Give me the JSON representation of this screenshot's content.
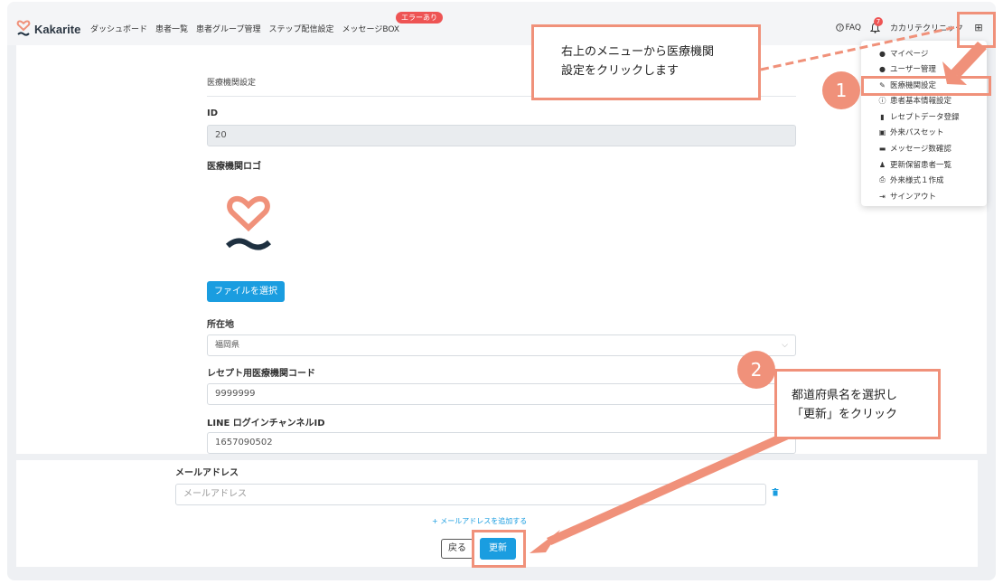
{
  "brand": {
    "name": "Kakarite"
  },
  "nav": {
    "links": [
      "ダッシュボード",
      "患者一覧",
      "患者グループ管理",
      "ステップ配信設定",
      "メッセージBOX"
    ],
    "error_badge": "エラーあり",
    "faq": "FAQ",
    "notification_count": "7",
    "user_name": "カカリテクリニック"
  },
  "form": {
    "section_title": "医療機関設定",
    "id_label": "ID",
    "id_value": "20",
    "logo_label": "医療機関ロゴ",
    "file_button": "ファイルを選択",
    "location_label": "所在地",
    "location_value": "福岡県",
    "receipt_code_label": "レセプト用医療機関コード",
    "receipt_code_value": "9999999",
    "line_id_label": "LINE ログインチャンネルID",
    "line_id_value": "1657090502",
    "email_label": "メールアドレス",
    "email_placeholder": "メールアドレス",
    "add_email": "+ メールアドレスを追加する",
    "back_button": "戻る",
    "update_button": "更新"
  },
  "dropdown": {
    "items": [
      {
        "label": "マイページ",
        "icon": "user-icon"
      },
      {
        "label": "ユーザー管理",
        "icon": "users-icon"
      },
      {
        "label": "医療機関設定",
        "icon": "pencil-icon"
      },
      {
        "label": "患者基本情報設定",
        "icon": "info-icon"
      },
      {
        "label": "レセプトデータ登録",
        "icon": "file-icon"
      },
      {
        "label": "外来パスセット",
        "icon": "briefcase-icon"
      },
      {
        "label": "メッセージ数確認",
        "icon": "comment-icon"
      },
      {
        "label": "更新保留患者一覧",
        "icon": "person-icon"
      },
      {
        "label": "外来様式１作成",
        "icon": "print-icon"
      },
      {
        "label": "サインアウト",
        "icon": "signout-icon"
      }
    ]
  },
  "annotations": {
    "callout1_lines": [
      "右上のメニューから医療機関",
      "設定をクリックします"
    ],
    "callout2_lines": [
      "都道府県名を選択し",
      "「更新」をクリック"
    ],
    "step1": "1",
    "step2": "2"
  },
  "colors": {
    "accent": "#1a9de0",
    "annotation": "#f0917a",
    "logo": "#f0917a",
    "logo_dark": "#1e3040"
  }
}
